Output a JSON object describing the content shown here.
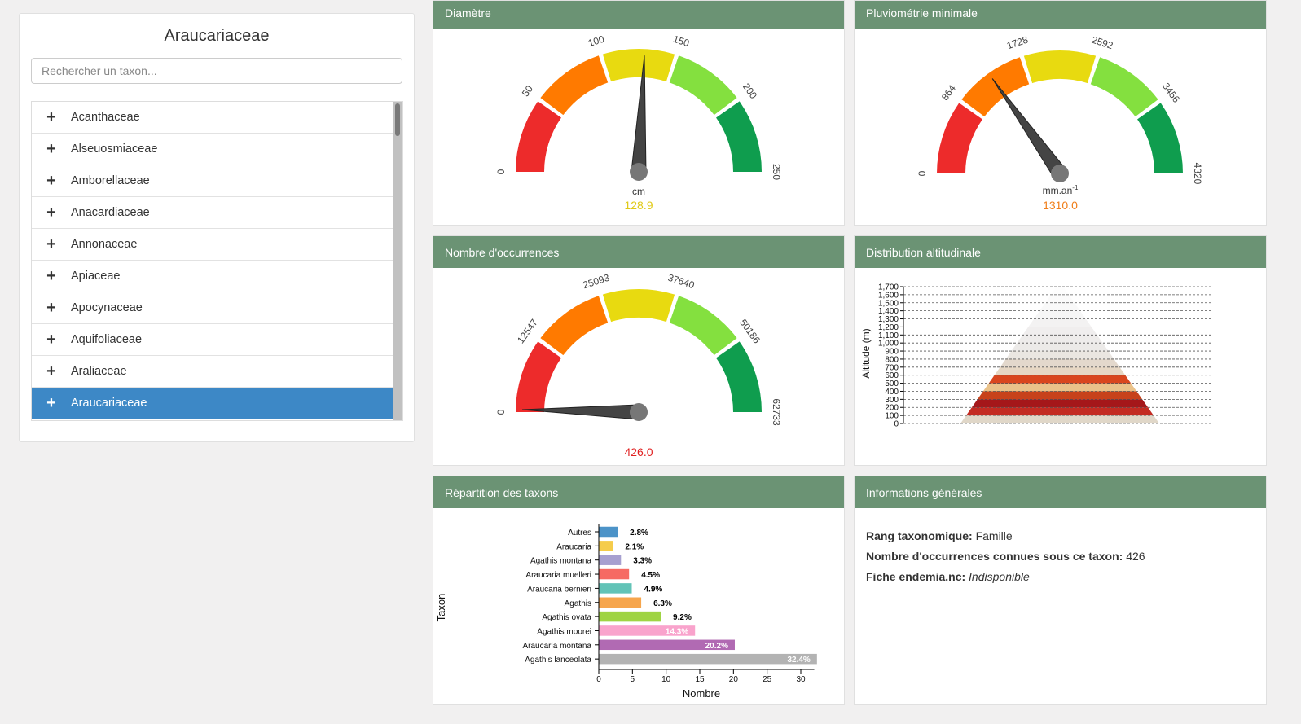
{
  "sidebar": {
    "title": "Araucariaceae",
    "search_placeholder": "Rechercher un taxon...",
    "items": [
      {
        "label": "Acanthaceae",
        "selected": false
      },
      {
        "label": "Alseuosmiaceae",
        "selected": false
      },
      {
        "label": "Amborellaceae",
        "selected": false
      },
      {
        "label": "Anacardiaceae",
        "selected": false
      },
      {
        "label": "Annonaceae",
        "selected": false
      },
      {
        "label": "Apiaceae",
        "selected": false
      },
      {
        "label": "Apocynaceae",
        "selected": false
      },
      {
        "label": "Aquifoliaceae",
        "selected": false
      },
      {
        "label": "Araliaceae",
        "selected": false
      },
      {
        "label": "Araucariaceae",
        "selected": true
      }
    ],
    "expand_icon": "plus-icon"
  },
  "colors": {
    "header_green": "#6b9374",
    "selected_blue": "#3d88c6",
    "gauge_bands": [
      "#ed2b2b",
      "#ff7a00",
      "#e8da10",
      "#84e03f",
      "#0f9d4e"
    ]
  },
  "cards": {
    "diametre": {
      "title": "Diamètre",
      "unit": "cm",
      "unit_sup": "",
      "value_text": "128.9",
      "value_color": "#e0c915",
      "min": 0,
      "max": 250,
      "value": 128.9,
      "ticks": [
        "0",
        "50",
        "100",
        "150",
        "200",
        "250"
      ]
    },
    "pluvio": {
      "title": "Pluviométrie minimale",
      "unit": "mm.an",
      "unit_sup": "-1",
      "value_text": "1310.0",
      "value_color": "#f07e1a",
      "min": 0,
      "max": 4320,
      "value": 1310,
      "ticks": [
        "0",
        "864",
        "1728",
        "2592",
        "3456",
        "4320"
      ]
    },
    "occurrences": {
      "title": "Nombre d'occurrences",
      "unit": "",
      "unit_sup": "",
      "value_text": "426.0",
      "value_color": "#e02020",
      "min": 0,
      "max": 62733,
      "value": 426,
      "ticks": [
        "0",
        "12547",
        "25093",
        "37640",
        "50186",
        "62733"
      ]
    },
    "altitude": {
      "title": "Distribution altitudinale",
      "ylabel": "Altitude (m)",
      "ticks": [
        "0",
        "100",
        "200",
        "300",
        "400",
        "500",
        "600",
        "700",
        "800",
        "900",
        "1,000",
        "1,100",
        "1,200",
        "1,300",
        "1,400",
        "1,500",
        "1,600",
        "1,700"
      ]
    },
    "repartition": {
      "title": "Répartition des taxons"
    },
    "info": {
      "title": "Informations générales",
      "rank_label": "Rang taxonomique:",
      "rank_value": "Famille",
      "occ_label": "Nombre d'occurrences connues sous ce taxon:",
      "occ_value": "426",
      "fiche_label": "Fiche endemia.nc:",
      "fiche_value": "Indisponible"
    }
  },
  "chart_data": [
    {
      "type": "bar",
      "orientation": "horizontal",
      "title": "",
      "xlabel": "Nombre",
      "ylabel": "Taxon",
      "xlim": [
        0,
        32
      ],
      "xticks": [
        0,
        5,
        10,
        15,
        20,
        25,
        30
      ],
      "categories": [
        "Autres",
        "Araucaria",
        "Agathis montana",
        "Araucaria muelleri",
        "Araucaria bernieri",
        "Agathis",
        "Agathis ovata",
        "Agathis moorei",
        "Araucaria montana",
        "Agathis lanceolata"
      ],
      "values": [
        2.8,
        2.1,
        3.3,
        4.5,
        4.9,
        6.3,
        9.2,
        14.3,
        20.2,
        32.4
      ],
      "labels": [
        "2.8%",
        "2.1%",
        "3.3%",
        "4.5%",
        "4.9%",
        "6.3%",
        "9.2%",
        "14.3%",
        "20.2%",
        "32.4%"
      ],
      "colors": [
        "#4c93c8",
        "#f5cc4b",
        "#a7a0d0",
        "#f66a63",
        "#62c3b7",
        "#f6a54c",
        "#9fd443",
        "#f9a3cc",
        "#b16ab3",
        "#b3b3b3"
      ]
    },
    {
      "type": "area",
      "title": "",
      "ylabel": "Altitude (m)",
      "ylim": [
        0,
        1700
      ],
      "bands": [
        {
          "from": 0,
          "to": 100,
          "color": "#e0d7c8"
        },
        {
          "from": 100,
          "to": 200,
          "color": "#c32b22"
        },
        {
          "from": 200,
          "to": 300,
          "color": "#a5171a"
        },
        {
          "from": 300,
          "to": 400,
          "color": "#c7421b"
        },
        {
          "from": 400,
          "to": 500,
          "color": "#eac28a"
        },
        {
          "from": 500,
          "to": 600,
          "color": "#d9461e"
        },
        {
          "from": 600,
          "to": 700,
          "color": "#e6d7c4"
        },
        {
          "from": 700,
          "to": 800,
          "color": "#e3d8cc"
        },
        {
          "from": 800,
          "to": 900,
          "color": "#eae6e1"
        },
        {
          "from": 900,
          "to": 1000,
          "color": "#eceae8"
        },
        {
          "from": 1000,
          "to": 1100,
          "color": "#eeeceb"
        },
        {
          "from": 1100,
          "to": 1200,
          "color": "#f0eeee"
        },
        {
          "from": 1200,
          "to": 1300,
          "color": "#f3f2f2"
        },
        {
          "from": 1300,
          "to": 1400,
          "color": "#f6f6f6"
        },
        {
          "from": 1400,
          "to": 1500,
          "color": "#f9f9f9"
        },
        {
          "from": 1500,
          "to": 1600,
          "color": "#fbfbfb"
        },
        {
          "from": 1600,
          "to": 1700,
          "color": "#fdfdfd"
        }
      ]
    }
  ]
}
